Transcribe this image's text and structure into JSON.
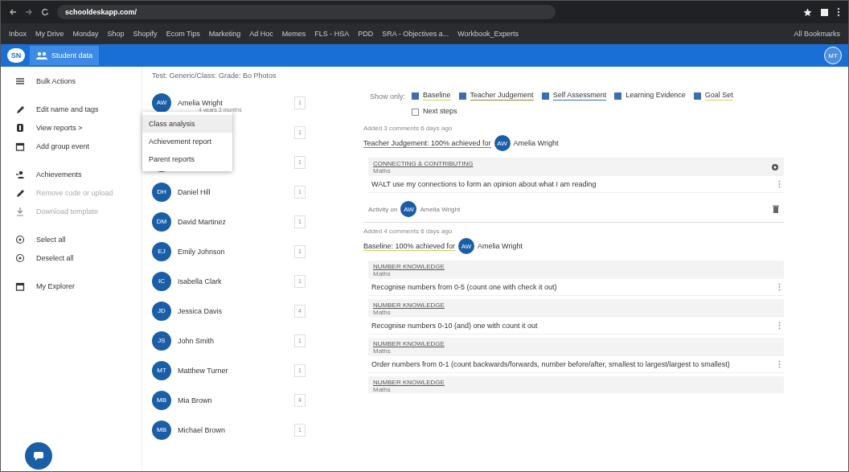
{
  "browser": {
    "url": "schooldeskapp.com/",
    "bookmarks": [
      "Inbox",
      "My Drive",
      "Monday",
      "Shop",
      "Shopify",
      "Ecom Tips",
      "Marketing",
      "Ad Hoc",
      "Memes",
      "FLS - HSA",
      "PDD",
      "SRA - Objectives a...",
      "Workbook_Experts"
    ],
    "all_bookmarks": "All Bookmarks"
  },
  "app_header": {
    "logo": "SN",
    "nav_button": "Student data",
    "user_initials": "MT"
  },
  "sidebar": {
    "items": [
      {
        "label": "Bulk Actions",
        "disabled": false
      },
      {
        "label": "Edit name and tags",
        "disabled": false
      },
      {
        "label": "View reports >",
        "disabled": false
      },
      {
        "label": "Add group event",
        "disabled": false
      },
      {
        "label": "Achievements",
        "disabled": false
      },
      {
        "label": "Remove code or upload",
        "disabled": true
      },
      {
        "label": "Download template",
        "disabled": true
      },
      {
        "label": "Select all",
        "disabled": false
      },
      {
        "label": "Deselect all",
        "disabled": false
      },
      {
        "label": "My Explorer",
        "disabled": false
      }
    ]
  },
  "students": {
    "heading": "Test: Generic/Class: Grade: Bo Photos",
    "rows": [
      {
        "initials": "AW",
        "name": "Amelia Wright",
        "note": "4 years 2 months",
        "count": "1"
      },
      {
        "count": "1"
      },
      {
        "count": "1"
      },
      {
        "initials": "DH",
        "name": "Daniel Hill",
        "count": "1"
      },
      {
        "initials": "DM",
        "name": "David Martinez",
        "count": "1"
      },
      {
        "initials": "EJ",
        "name": "Emily Johnson",
        "count": "1"
      },
      {
        "initials": "IC",
        "name": "Isabella Clark",
        "count": "1"
      },
      {
        "initials": "JD",
        "name": "Jessica Davis",
        "count": "4"
      },
      {
        "initials": "JS",
        "name": "John Smith",
        "count": "1"
      },
      {
        "initials": "MT",
        "name": "Matthew Turner",
        "count": "1"
      },
      {
        "initials": "MB",
        "name": "Mia Brown",
        "count": "4"
      },
      {
        "initials": "MB",
        "name": "Michael Brown",
        "count": "1"
      }
    ],
    "menu": [
      {
        "label": "Class analysis",
        "selected": true
      },
      {
        "label": "Achievement report",
        "selected": false
      },
      {
        "label": "Parent reports",
        "selected": false
      }
    ]
  },
  "filters": {
    "label": "Show only:",
    "items": [
      {
        "label": "Baseline",
        "checked": true,
        "color": "#c8d45a"
      },
      {
        "label": "Teacher Judgement",
        "checked": true,
        "color": "#8a8a2a"
      },
      {
        "label": "Self Assessment",
        "checked": true,
        "color": "#3a6fb0"
      },
      {
        "label": "Learning Evidence",
        "checked": true
      },
      {
        "label": "Goal Set",
        "checked": true,
        "color": "#e0d060"
      },
      {
        "label": "Next steps",
        "checked": false
      }
    ]
  },
  "sections": [
    {
      "meta": "Added 3 comments 6 days ago",
      "title": "Teacher Judgement: 100% achieved for",
      "color": "#8a8a2a",
      "initials": "AW",
      "student": "Amelia Wright",
      "cards": [
        {
          "code": "CONNECTING & CONTRIBUTING",
          "subject": "Maths",
          "text": "WALT use my connections to form an opinion about what I am reading",
          "gear": true
        }
      ],
      "activity": {
        "prefix": "Activity on",
        "initials": "AW",
        "name": "Amelia Wright"
      }
    },
    {
      "meta": "Added 4 comments 6 days ago",
      "title": "Baseline: 100% achieved for",
      "color": "#c8d45a",
      "initials": "AW",
      "student": "Amelia Wright",
      "cards": [
        {
          "code": "NUMBER KNOWLEDGE",
          "subject": "Maths",
          "text": "Recognise numbers from 0-5 (count one with check it out)",
          "gear": false
        },
        {
          "code": "NUMBER KNOWLEDGE",
          "subject": "Maths",
          "text": "Recognise numbers 0-10 (and) one with count it out",
          "gear": false
        },
        {
          "code": "NUMBER KNOWLEDGE",
          "subject": "Maths",
          "text": "Order numbers from 0-1 (count backwards/forwards, number before/after, smallest to largest/largest to smallest)",
          "gear": false
        },
        {
          "code": "NUMBER KNOWLEDGE",
          "subject": "Maths",
          "gear": false
        }
      ]
    }
  ]
}
